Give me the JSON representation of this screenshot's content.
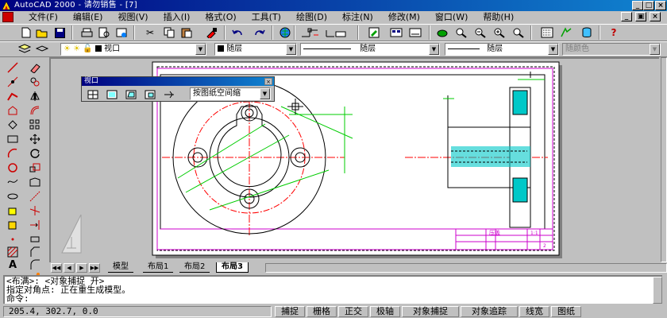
{
  "window": {
    "title": "AutoCAD 2000 - 请勿销售 - [7]",
    "controls": {
      "minimize": "_",
      "maximize": "□",
      "close": "×"
    }
  },
  "menubar": {
    "items": [
      {
        "label": "文件(F)"
      },
      {
        "label": "编辑(E)"
      },
      {
        "label": "视图(V)"
      },
      {
        "label": "插入(I)"
      },
      {
        "label": "格式(O)"
      },
      {
        "label": "工具(T)"
      },
      {
        "label": "绘图(D)"
      },
      {
        "label": "标注(N)"
      },
      {
        "label": "修改(M)"
      },
      {
        "label": "窗口(W)"
      },
      {
        "label": "帮助(H)"
      }
    ],
    "doc_controls": {
      "minimize": "_",
      "restore": "▣",
      "close": "×"
    }
  },
  "standard_toolbar": {
    "icons": [
      "new-icon",
      "open-icon",
      "save-icon",
      "print-icon",
      "preview-icon",
      "publish-icon",
      "cut-icon",
      "copy-icon",
      "paste-icon",
      "match-properties-icon",
      "undo-icon",
      "redo-icon",
      "hyperlink-icon",
      "snap-from-icon",
      "ucs-icon",
      "properties-icon",
      "design-center-icon",
      "pan-icon",
      "zoom-realtime-icon",
      "zoom-window-icon",
      "zoom-previous-icon",
      "aerial-view-icon",
      "help-icon"
    ],
    "help_label": "?"
  },
  "properties_toolbar": {
    "layer_value": "视口",
    "color_value": "随层",
    "linetype_value": "随层",
    "lineweight_value": "随层",
    "plotstyle_value": "随颜色"
  },
  "viewport_palette": {
    "title": "视口",
    "scale_value": "按图纸空间缩"
  },
  "layout_tabs": {
    "tabs": [
      {
        "label": "模型",
        "active": false
      },
      {
        "label": "布局1",
        "active": false
      },
      {
        "label": "布局2",
        "active": false
      },
      {
        "label": "布局3",
        "active": true
      }
    ]
  },
  "command_line": {
    "lines": [
      "<布满>: <对象捕捉 开>",
      "指定对角点: 正在重生成模型。",
      "命令:"
    ]
  },
  "statusbar": {
    "coords": "205.4, 302.7, 0.0",
    "toggles": [
      "捕捉",
      "栅格",
      "正交",
      "极轴",
      "对象捕捉",
      "对象追踪",
      "线宽",
      "图纸"
    ]
  },
  "drawing": {
    "title_block_label": "压盖",
    "title_block_scale": "1:1",
    "title_block_sheet": "2"
  },
  "colors": {
    "title_gradient_start": "#000080",
    "title_gradient_end": "#1084d0",
    "paper": "#ffffff",
    "border_magenta": "#cc00cc",
    "centerline_red": "#ff0000",
    "dimension_green": "#00cc00",
    "hatch_cyan": "#00c8c8"
  }
}
